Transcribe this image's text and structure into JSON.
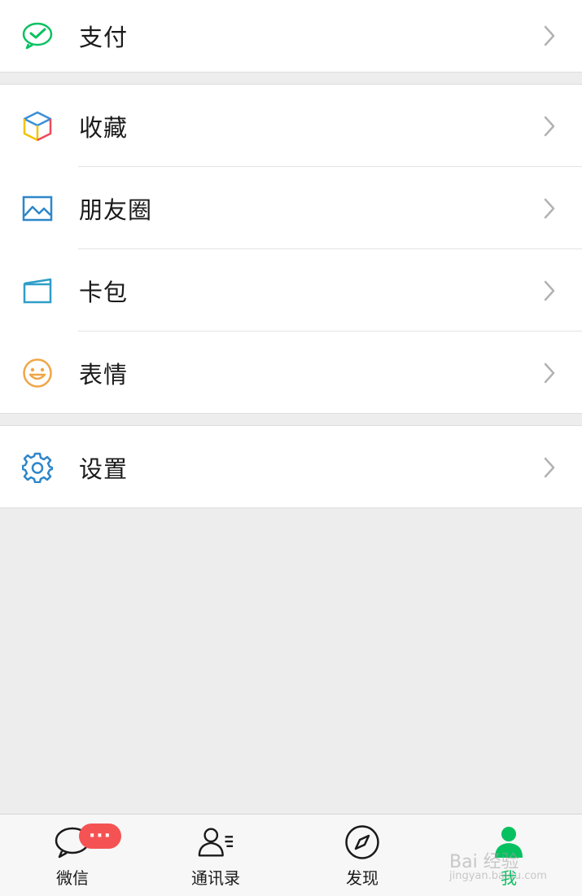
{
  "menu": {
    "pay": {
      "label": "支付"
    },
    "favorites": {
      "label": "收藏"
    },
    "moments": {
      "label": "朋友圈"
    },
    "cards": {
      "label": "卡包"
    },
    "stickers": {
      "label": "表情"
    },
    "settings": {
      "label": "设置"
    }
  },
  "tabbar": {
    "chats": {
      "label": "微信",
      "badge": "···"
    },
    "contacts": {
      "label": "通讯录"
    },
    "discover": {
      "label": "发现"
    },
    "me": {
      "label": "我"
    }
  },
  "watermark": {
    "text": "Bai 经验",
    "sub": "jingyan.baidu.com"
  },
  "colors": {
    "accent": "#07c160",
    "badge": "#f55353",
    "background": "#ededed"
  }
}
